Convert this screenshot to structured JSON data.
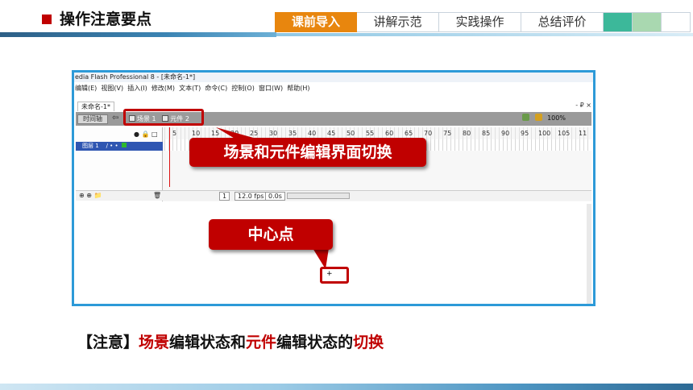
{
  "header": {
    "title": "操作注意要点",
    "tabs": [
      {
        "label": "课前导入",
        "active": true
      },
      {
        "label": "讲解示范",
        "active": false
      },
      {
        "label": "实践操作",
        "active": false
      },
      {
        "label": "总结评价",
        "active": false
      }
    ],
    "swatches": [
      "#3cb89a",
      "#a9d8b0",
      "#ffffff"
    ],
    "accent": "#c00000",
    "active_tab_color": "#e8860e"
  },
  "screenshot": {
    "window_title": "edia Flash Professional 8 - [未命名-1*]",
    "menu": [
      "编辑(E)",
      "视图(V)",
      "插入(I)",
      "修改(M)",
      "文本(T)",
      "命令(C)",
      "控制(O)",
      "窗口(W)",
      "帮助(H)"
    ],
    "document_tab": "未命名-1*",
    "window_controls": "- ₽ ×",
    "timeline_button": "时间轴",
    "back_arrow": "⇦",
    "breadcrumb": {
      "scene": "场景 1",
      "symbol": "元件 2"
    },
    "zoom": "100%",
    "layer_name": "图层 1",
    "layer_flags": "/ • •",
    "layer_header_icons": "● 🔒 □",
    "ruler": [
      "5",
      "10",
      "15",
      "20",
      "25",
      "30",
      "35",
      "40",
      "45",
      "50",
      "55",
      "60",
      "65",
      "70",
      "75",
      "80",
      "85",
      "90",
      "95",
      "100",
      "105",
      "11"
    ],
    "frame_number": "1",
    "fps": "12.0 fps",
    "elapsed": "0.0s",
    "footer_icons": "⊕ ⊕ 📁",
    "trash_icon": "🗑",
    "center_marker": "+"
  },
  "callouts": {
    "edit_switch": "场景和元件编辑界面切换",
    "center_point": "中心点"
  },
  "note": {
    "prefix": "【注意】",
    "part1": "场景",
    "part2": "编辑状态和",
    "part3": "元件",
    "part4": "编辑状态的",
    "part5": "切换"
  }
}
